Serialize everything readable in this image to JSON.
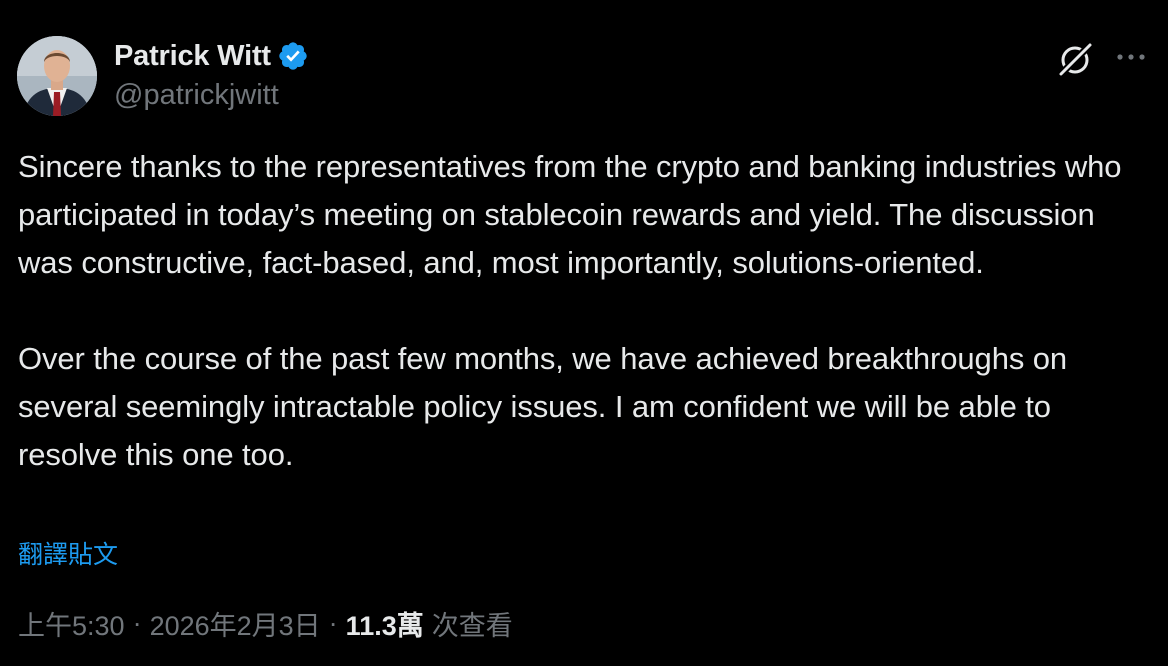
{
  "author": {
    "display_name": "Patrick Witt",
    "handle": "@patrickjwitt",
    "verified": true
  },
  "tweet": {
    "paragraphs": [
      "Sincere thanks to the representatives from the crypto and banking industries who participated in today’s meeting on stablecoin rewards and yield. The discussion was constructive, fact-based, and, most importantly, solutions-oriented.",
      "Over the course of the past few months, we have achieved breakthroughs on several seemingly intractable policy issues. I am confident we will be able to resolve this one too."
    ],
    "translate_label": "翻譯貼文"
  },
  "meta": {
    "time": "上午5:30",
    "separator": "·",
    "date": "2026年2月3日",
    "views_count": "11.3萬",
    "views_label": "次查看"
  },
  "icons": {
    "verified": "verified-badge-icon",
    "grok": "grok-icon",
    "more": "more-options-icon"
  },
  "colors": {
    "background": "#000000",
    "text_primary": "#e7e9ea",
    "text_secondary": "#71767b",
    "accent": "#1d9bf0"
  }
}
